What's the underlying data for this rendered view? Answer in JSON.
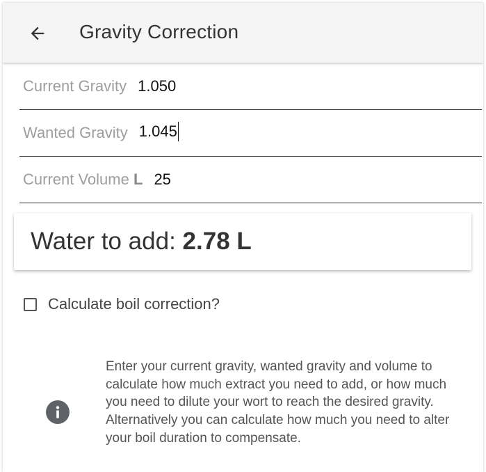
{
  "appbar": {
    "title": "Gravity Correction",
    "back_icon": "arrow-left-icon"
  },
  "fields": {
    "current_gravity": {
      "label": "Current Gravity",
      "value": "1.050"
    },
    "wanted_gravity": {
      "label": "Wanted Gravity",
      "value": "1.045"
    },
    "current_volume": {
      "label": "Current Volume",
      "unit": "L",
      "value": "25"
    }
  },
  "result": {
    "label": "Water to add:",
    "value": "2.78 L"
  },
  "boil_correction": {
    "label": "Calculate boil correction?",
    "checked": false
  },
  "info": {
    "icon": "info-icon",
    "text": "Enter your current gravity, wanted gravity and volume to calculate how much extract you need to add, or how much you need to dilute your wort to reach the desired gravity. Alternatively you can calculate how much you need to alter your boil duration to compensate."
  },
  "colors": {
    "appbar_bg": "#f5f5f5",
    "text_primary": "#333333",
    "label_gray": "#9e9e9e",
    "icon_gray": "#5f6368"
  }
}
